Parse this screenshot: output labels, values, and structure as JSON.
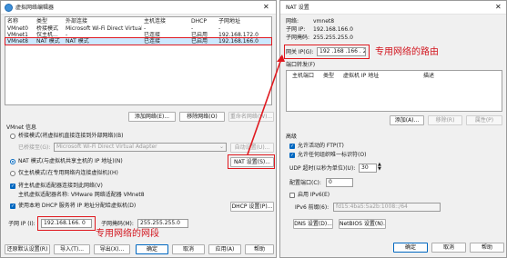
{
  "vne": {
    "title": "虚拟网络编辑器",
    "table": {
      "headers": [
        "名称",
        "类型",
        "外部连接",
        "主机连接",
        "DHCP",
        "子网地址"
      ],
      "rows": [
        [
          "VMnet0",
          "桥接模式",
          "Microsoft Wi-Fi Direct Virtual A...",
          "-",
          "-",
          "-"
        ],
        [
          "VMnet1",
          "仅主机...",
          "-",
          "已连接",
          "已启用",
          "192.168.172.0"
        ],
        [
          "VMnet8",
          "NAT 模式",
          "NAT 模式",
          "已连接",
          "已启用",
          "192.168.166.0"
        ]
      ]
    },
    "buttons": {
      "add_network": "添加网络(E)...",
      "remove_network": "移除网络(O)",
      "rename_network": "重命名网络(W)..."
    },
    "info_title": "VMnet 信息",
    "bridged_label": "桥接模式(将虚拟机直接连接到外部网络)(B)",
    "bridged_to_label": "已桥接至(G):",
    "bridged_to_value": "Microsoft Wi-Fi Direct Virtual Adapter",
    "auto_settings": "自动设置(U)...",
    "nat_label": "NAT 模式(与虚拟机共享主机的 IP 地址)(N)",
    "nat_settings": "NAT 设置(S)...",
    "hostonly_label": "仅主机模式(在专用网络内连接虚拟机)(H)",
    "connect_adapter_label": "将主机虚拟适配器连接到此网络(V)",
    "adapter_name_label": "主机虚拟适配器名称: VMware 网络适配器 VMnet8",
    "dhcp_label": "使用本地 DHCP 服务将 IP 地址分配给虚拟机(D)",
    "dhcp_settings": "DHCP 设置(P)...",
    "subnet_ip_label": "子网 IP (I):",
    "subnet_ip_value": "192.168.166. 0",
    "subnet_mask_label": "子网掩码(M):",
    "subnet_mask_value": "255.255.255.0",
    "footer": {
      "restore": "还原默认设置(R)",
      "import": "导入(T)...",
      "export": "导出(X)...",
      "ok": "确定",
      "cancel": "取消",
      "apply": "应用(A)",
      "help": "帮助"
    }
  },
  "nat": {
    "title": "NAT 设置",
    "network_label": "网络:",
    "network_value": "vmnet8",
    "subnet_ip_label": "子网 IP:",
    "subnet_ip_value": "192.168.166.0",
    "subnet_mask_label": "子网掩码:",
    "subnet_mask_value": "255.255.255.0",
    "gateway_label": "网关 IP(G):",
    "gateway_value": "192 .168 .166 . 2",
    "port_forward_title": "端口转发(F)",
    "pf_headers": [
      "主机端口",
      "类型",
      "虚拟机 IP 地址",
      "描述"
    ],
    "pf_buttons": {
      "add": "添加(A)...",
      "remove": "移除(R)",
      "properties": "属性(P)"
    },
    "advanced_title": "高级",
    "allow_ftp": "允许活动的 FTP(T)",
    "allow_oui": "允许任何组织唯一标识符(O)",
    "udp_label": "UDP 超时(以秒为单位)(U):",
    "udp_value": "30",
    "config_port_label": "配置端口(C):",
    "config_port_value": "0",
    "enable_ipv6": "启用 IPv6(E)",
    "ipv6_prefix_label": "IPv6 前缀(6):",
    "ipv6_prefix_value": "fd15:4ba5:5a2b:1008::/64",
    "dns_settings": "DNS 设置(D)...",
    "netbios_settings": "NetBIOS 设置(N)...",
    "ok": "确定",
    "cancel": "取消",
    "help": "帮助"
  },
  "annotations": {
    "gateway_note": "专用网络的路由",
    "segment_note": "专用网络的网段"
  },
  "colors": {
    "accent": "#0067c0",
    "highlight": "#cce8ff",
    "annotation": "#e0191f"
  }
}
